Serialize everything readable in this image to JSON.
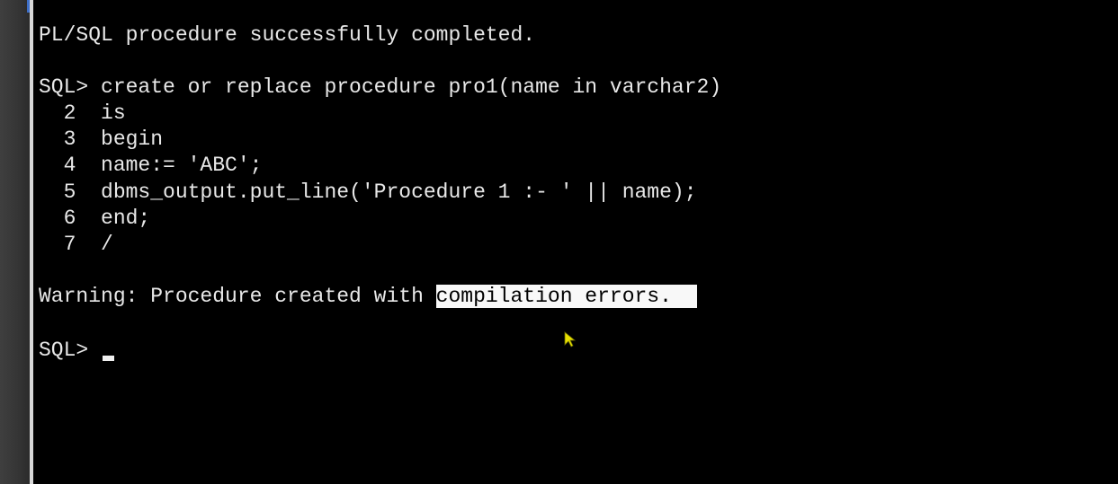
{
  "console": {
    "lines": [
      "PL/SQL procedure successfully completed.",
      "SQL> create or replace procedure pro1(name in varchar2)",
      "  2  is",
      "  3  begin",
      "  4  name:= 'ABC';",
      "  5  dbms_output.put_line('Procedure 1 :- ' || name);",
      "  6  end;",
      "  7  /"
    ],
    "warning_prefix": "Warning: Procedure created with ",
    "warning_highlighted": "compilation errors.",
    "prompt": "SQL> "
  },
  "colors": {
    "background": "#000000",
    "text": "#e8e8e8",
    "highlight_bg": "#f8f8f8",
    "highlight_text": "#000000",
    "mouse_pointer": "#e8e000"
  },
  "icons": {
    "pointer": "mouse-pointer-icon",
    "cursor": "text-cursor-icon"
  }
}
